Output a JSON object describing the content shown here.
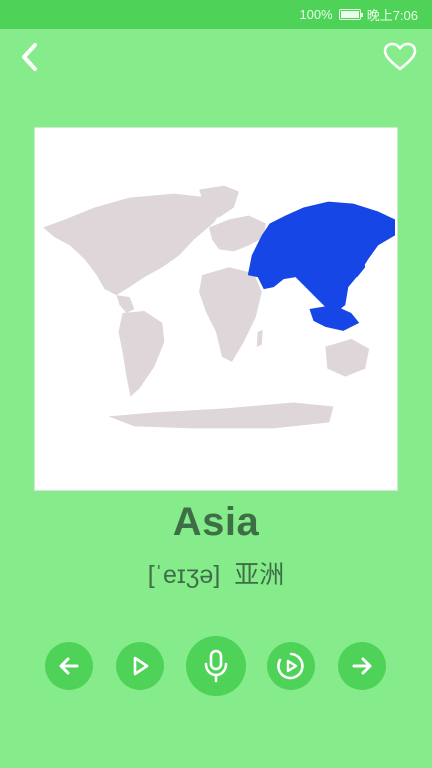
{
  "status_bar": {
    "battery": "100%",
    "time": "晚上7:06"
  },
  "header": {
    "back_icon": "chevron-left-icon",
    "favorite_icon": "heart-outline-icon"
  },
  "card": {
    "image": "world-map-asia-highlighted",
    "highlight_color": "#1646e6",
    "land_color": "#ded6d8"
  },
  "word": {
    "text": "Asia",
    "phonetic": "[ˈeɪʒə]",
    "translation": "亚洲"
  },
  "controls": [
    {
      "name": "previous-button",
      "icon": "arrow-left-icon"
    },
    {
      "name": "play-button",
      "icon": "play-icon"
    },
    {
      "name": "record-button",
      "icon": "microphone-icon"
    },
    {
      "name": "replay-recording-button",
      "icon": "circle-play-icon"
    },
    {
      "name": "next-button",
      "icon": "arrow-right-icon"
    }
  ],
  "colors": {
    "background": "#86ec8b",
    "accent": "#4ed257",
    "text": "#3e6e46"
  }
}
